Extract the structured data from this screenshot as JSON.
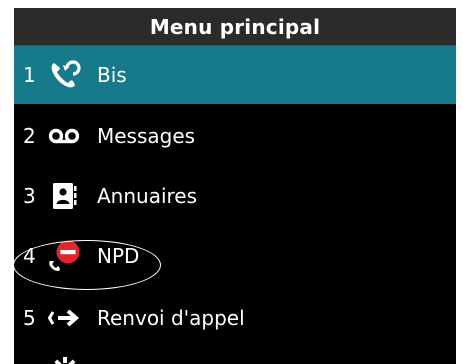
{
  "header": {
    "title": "Menu principal"
  },
  "menu": {
    "items": [
      {
        "number": "1",
        "label": "Bis",
        "icon": "redial-phone-icon"
      },
      {
        "number": "2",
        "label": "Messages",
        "icon": "voicemail-icon"
      },
      {
        "number": "3",
        "label": "Annuaires",
        "icon": "directory-icon"
      },
      {
        "number": "4",
        "label": "NPD",
        "icon": "do-not-disturb-icon"
      },
      {
        "number": "5",
        "label": "Renvoi d'appel",
        "icon": "call-forward-icon"
      }
    ],
    "selected_index": 0
  },
  "colors": {
    "background": "#000000",
    "titlebar": "#2b2b2b",
    "selected": "#167a8a",
    "dnd_red": "#e0262f",
    "text": "#ffffff"
  }
}
